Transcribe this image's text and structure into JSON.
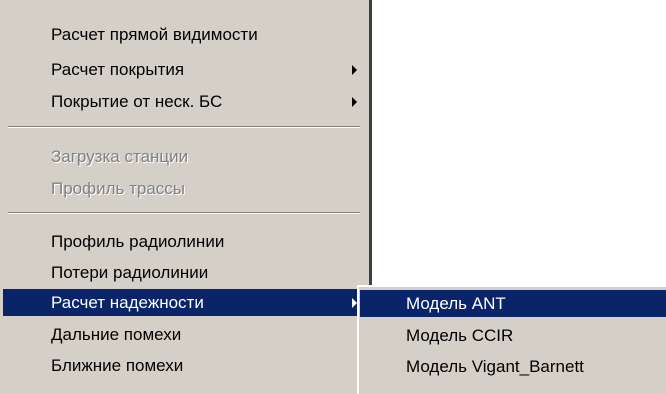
{
  "main_menu": {
    "items": [
      {
        "label": "Расчет прямой видимости"
      },
      {
        "label": "Расчет покрытия"
      },
      {
        "label": "Покрытие от неск. БС"
      },
      {
        "label": "Загрузка станции"
      },
      {
        "label": "Профиль трассы"
      },
      {
        "label": "Профиль радиолинии"
      },
      {
        "label": "Потери радиолинии"
      },
      {
        "label": "Расчет надежности"
      },
      {
        "label": "Дальние помехи"
      },
      {
        "label": "Ближние помехи"
      }
    ]
  },
  "submenu": {
    "items": [
      {
        "label": "Модель ANT"
      },
      {
        "label": "Модель CCIR"
      },
      {
        "label": "Модель Vigant_Barnett"
      }
    ]
  },
  "colors": {
    "menu_background": "#d4d0c8",
    "selection_background": "#0a246a",
    "selection_text": "#ffffff",
    "disabled_text": "#808080"
  }
}
